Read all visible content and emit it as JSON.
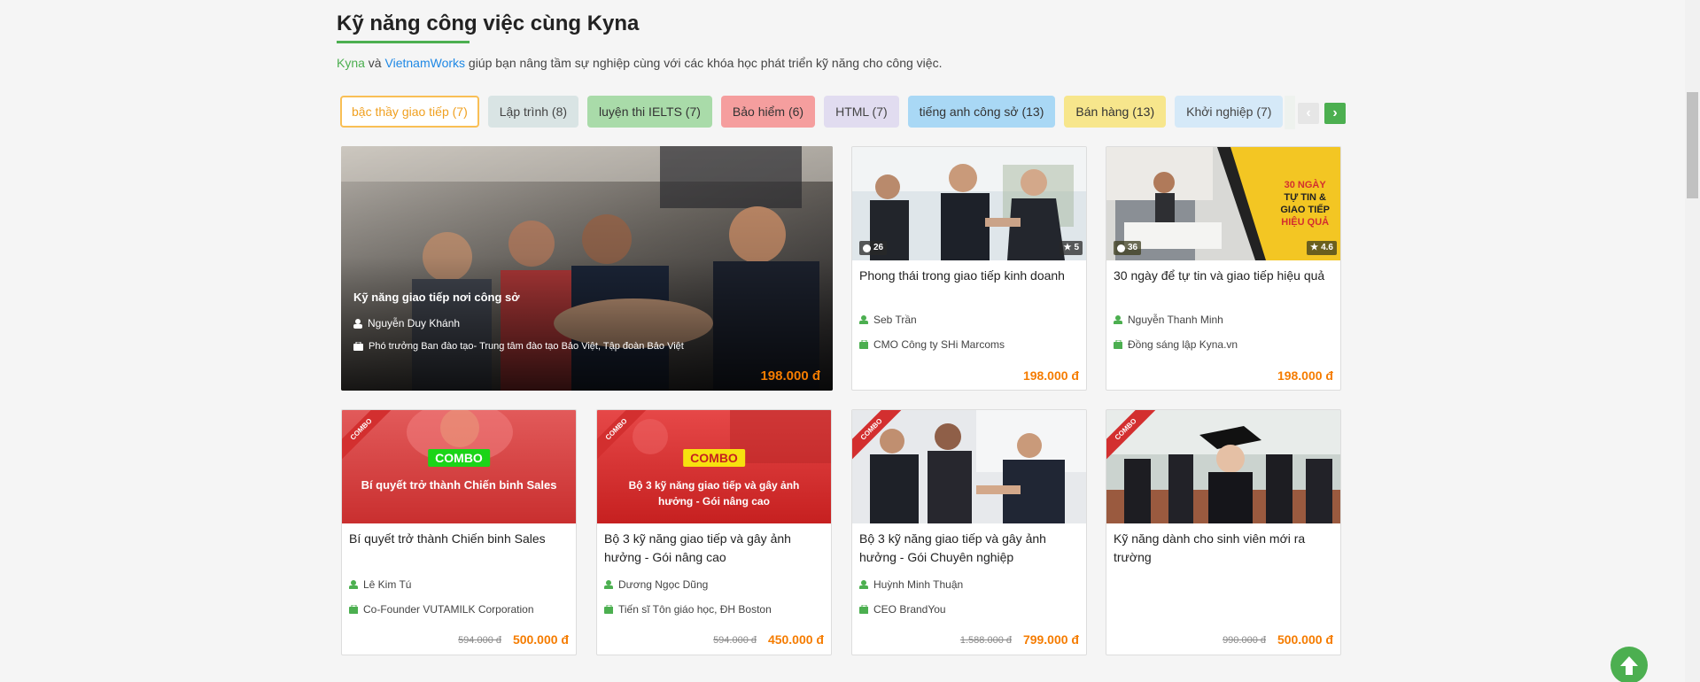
{
  "section": {
    "title": "Kỹ năng công việc cùng Kyna",
    "intro_link1": "Kyna",
    "intro_and": " và ",
    "intro_link2": "VietnamWorks",
    "intro_rest": " giúp bạn nâng tầm sự nghiệp cùng với các khóa học phát triển kỹ năng cho công việc."
  },
  "tabs": [
    {
      "label": "bậc thầy giao tiếp (7)",
      "bg": "#ffffff",
      "color": "#f0a020"
    },
    {
      "label": "Lập trình (8)",
      "bg": "#d9e4e4",
      "color": "#444444"
    },
    {
      "label": "luyện thi IELTS (7)",
      "bg": "#a9dba9",
      "color": "#333333"
    },
    {
      "label": "Bảo hiểm (6)",
      "bg": "#f59e9e",
      "color": "#333333"
    },
    {
      "label": "HTML (7)",
      "bg": "#e1dcf0",
      "color": "#444444"
    },
    {
      "label": "tiếng anh công sở (13)",
      "bg": "#a9d8f5",
      "color": "#333333"
    },
    {
      "label": "Bán hàng (13)",
      "bg": "#f7e68c",
      "color": "#333333"
    },
    {
      "label": "Khởi nghiệp (7)",
      "bg": "#d5e9f8",
      "color": "#444444"
    }
  ],
  "nav": {
    "prev": "‹",
    "next": "›"
  },
  "featured": {
    "title": "Kỹ năng giao tiếp nơi công sở",
    "author": "Nguyễn Duy Khánh",
    "position": "Phó trưởng Ban đào tạo- Trung tâm đào tạo Bảo Việt, Tập đoàn Bảo Việt",
    "price": "198.000 đ"
  },
  "cards": [
    {
      "title": "Phong thái trong giao tiếp kinh doanh",
      "author": "Seb Trần",
      "position": "CMO Công ty SHi Marcoms",
      "price": "198.000 đ",
      "lessons": "26",
      "rating": "5"
    },
    {
      "title": "30 ngày để tự tin và giao tiếp hiệu quả",
      "author": "Nguyễn Thanh Minh",
      "position": "Đồng sáng lập Kyna.vn",
      "price": "198.000 đ",
      "lessons": "36",
      "rating": "4.6",
      "banner": [
        "30 NGÀY",
        "TỰ TIN &",
        "GIAO TIẾP",
        "HIỆU QUẢ"
      ]
    },
    {
      "title": "Bí quyết trở thành Chiến binh Sales",
      "author": "Lê Kim Tú",
      "position": "Co-Founder VUTAMILK Corporation",
      "old_price": "594.000 đ",
      "price": "500.000 đ",
      "ribbon": "COMBO",
      "combo_label": "COMBO",
      "combo_text": "Bí quyết trở thành Chiến binh Sales"
    },
    {
      "title": "Bộ 3 kỹ năng giao tiếp và gây ảnh hưởng - Gói nâng cao",
      "author": "Dương Ngọc Dũng",
      "position": "Tiến sĩ Tôn giáo học, ĐH Boston",
      "old_price": "594.000 đ",
      "price": "450.000 đ",
      "ribbon": "COMBO",
      "combo_label": "COMBO",
      "combo_text": "Bộ 3 kỹ năng giao tiếp và gây ảnh hưởng - Gói nâng cao"
    },
    {
      "title": "Bộ 3 kỹ năng giao tiếp và gây ảnh hưởng - Gói Chuyên nghiệp",
      "author": "Huỳnh Minh Thuận",
      "position": "CEO BrandYou",
      "old_price": "1.588.000 đ",
      "price": "799.000 đ",
      "ribbon": "COMBO"
    },
    {
      "title": "Kỹ năng dành cho sinh viên mới ra trường",
      "author": "",
      "position": "",
      "old_price": "990.000 đ",
      "price": "500.000 đ",
      "ribbon": "COMBO"
    }
  ],
  "colors": {
    "accent": "#4caf50",
    "price": "#f57c00",
    "link": "#1e88e5"
  }
}
